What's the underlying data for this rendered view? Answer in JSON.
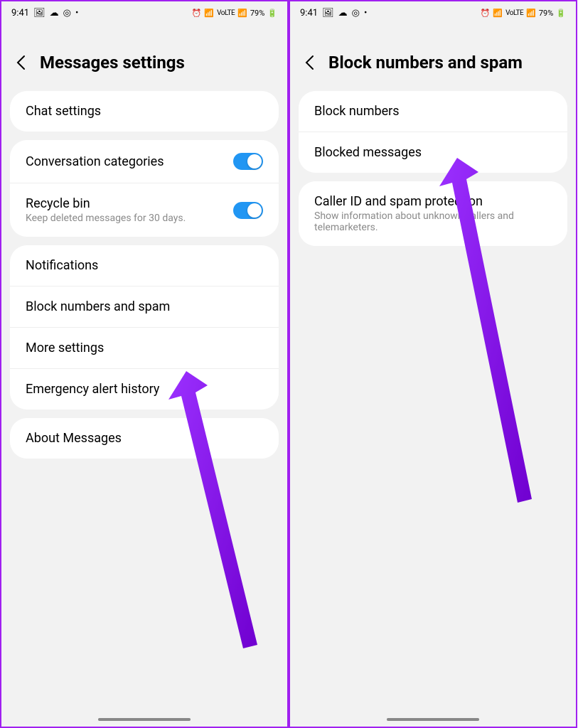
{
  "statusBar": {
    "time": "9:41",
    "battery": "79%"
  },
  "screenLeft": {
    "title": "Messages settings",
    "card1": {
      "chatSettings": "Chat settings"
    },
    "card2": {
      "conversationCategories": "Conversation categories",
      "recycleBinTitle": "Recycle bin",
      "recycleBinSubtitle": "Keep deleted messages for 30 days."
    },
    "card3": {
      "notifications": "Notifications",
      "blockNumbers": "Block numbers and spam",
      "moreSettings": "More settings",
      "emergency": "Emergency alert history"
    },
    "card4": {
      "about": "About Messages"
    }
  },
  "screenRight": {
    "title": "Block numbers and spam",
    "card1": {
      "blockNumbers": "Block numbers",
      "blockedMessages": "Blocked messages"
    },
    "card2": {
      "callerIdTitle": "Caller ID and spam protection",
      "callerIdSubtitle": "Show information about unknown callers and telemarketers."
    }
  }
}
